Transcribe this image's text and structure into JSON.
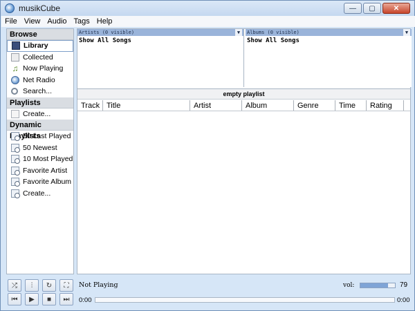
{
  "window": {
    "title": "musikCube"
  },
  "window_controls": {
    "minimize": "—",
    "maximize": "▢",
    "close": "✕"
  },
  "menu": [
    "File",
    "View",
    "Audio",
    "Tags",
    "Help"
  ],
  "sidebar": {
    "browse": {
      "header": "Browse",
      "items": [
        {
          "label": "Library",
          "icon": "library-icon",
          "active": true
        },
        {
          "label": "Collected",
          "icon": "collected-icon"
        },
        {
          "label": "Now Playing",
          "icon": "music-note-icon"
        },
        {
          "label": "Net Radio",
          "icon": "globe-icon"
        },
        {
          "label": "Search...",
          "icon": "search-icon"
        }
      ]
    },
    "playlists": {
      "header": "Playlists",
      "items": [
        {
          "label": "Create...",
          "icon": "page-icon"
        }
      ]
    },
    "dynamic": {
      "header": "Dynamic Playlists",
      "items": [
        {
          "label": "50 Last Played"
        },
        {
          "label": "50 Newest"
        },
        {
          "label": "10 Most Played"
        },
        {
          "label": "Favorite Artist"
        },
        {
          "label": "Favorite Album"
        },
        {
          "label": "Create..."
        }
      ]
    }
  },
  "filters": {
    "artists": {
      "header": "Artists (0 visible)",
      "row": "Show All Songs"
    },
    "albums": {
      "header": "Albums (0 visible)",
      "row": "Show All Songs"
    }
  },
  "playlist": {
    "title": "empty playlist"
  },
  "columns": [
    {
      "label": "Track"
    },
    {
      "label": "Title"
    },
    {
      "label": "Artist"
    },
    {
      "label": "Album"
    },
    {
      "label": "Genre"
    },
    {
      "label": "Time"
    },
    {
      "label": "Rating"
    }
  ],
  "player": {
    "status": "Not Playing",
    "volume_label": "vol:",
    "volume": 79,
    "time_elapsed": "0:00",
    "time_total": "0:00"
  },
  "colors": {
    "accent": "#9ab4da",
    "frame": "#d6e6f7",
    "volume_fill": "#7fa4d6"
  }
}
